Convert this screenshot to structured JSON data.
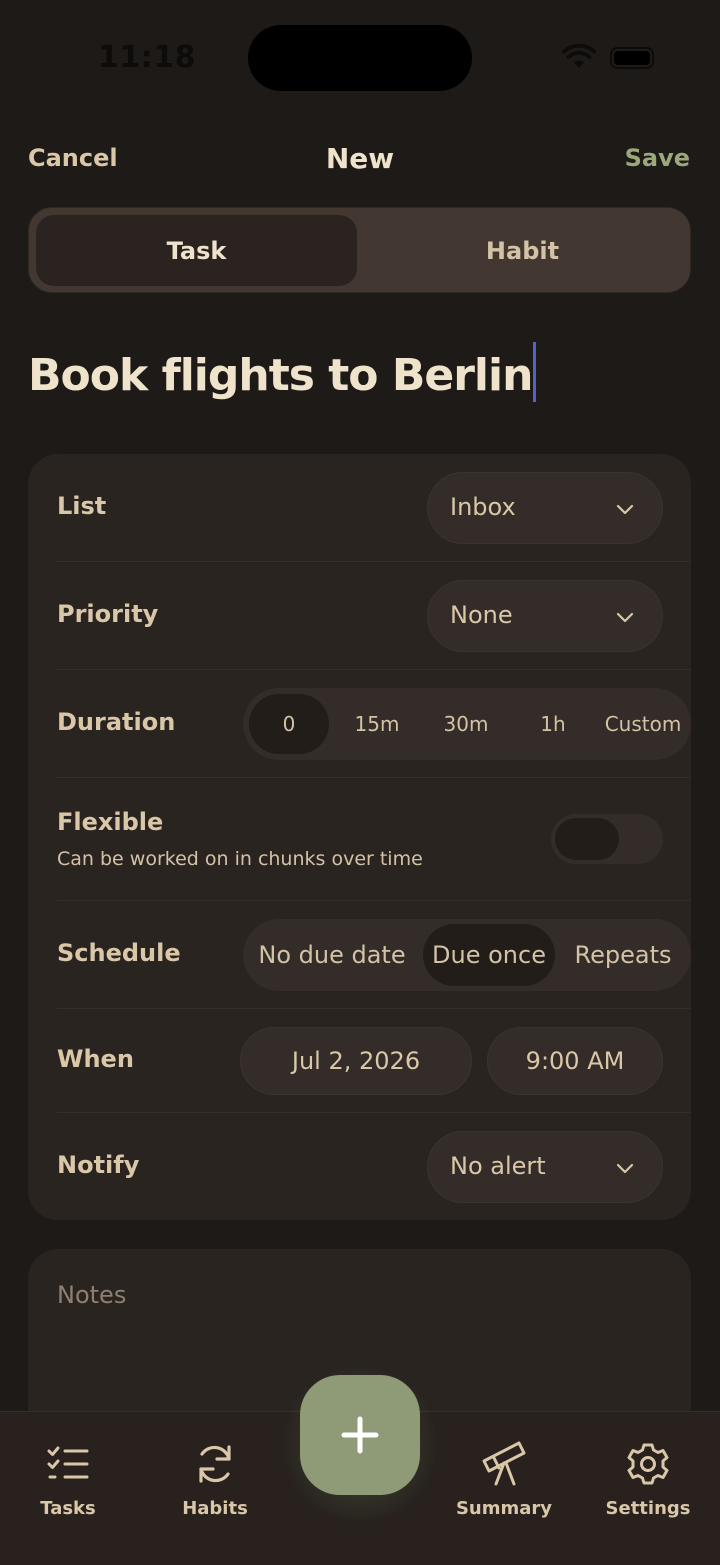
{
  "status_bar": {
    "time": "11:18"
  },
  "nav": {
    "cancel_label": "Cancel",
    "title": "New",
    "save_label": "Save"
  },
  "type_segment": {
    "options": [
      "Task",
      "Habit"
    ],
    "selected": "Task"
  },
  "task_title": "Book flights to Berlin",
  "form": {
    "list": {
      "label": "List",
      "value": "Inbox"
    },
    "priority": {
      "label": "Priority",
      "value": "None"
    },
    "duration": {
      "label": "Duration",
      "options": [
        "0",
        "15m",
        "30m",
        "1h",
        "Custom"
      ],
      "selected": "0"
    },
    "flexible": {
      "label": "Flexible",
      "description": "Can be worked on in chunks over time",
      "enabled": false
    },
    "schedule": {
      "label": "Schedule",
      "options": [
        "No due date",
        "Due once",
        "Repeats"
      ],
      "selected": "Due once"
    },
    "when": {
      "label": "When",
      "date": "Jul 2, 2026",
      "time": "9:00 AM"
    },
    "notify": {
      "label": "Notify",
      "value": "No alert"
    }
  },
  "notes": {
    "placeholder": "Notes"
  },
  "tabbar": {
    "tasks": "Tasks",
    "habits": "Habits",
    "summary": "Summary",
    "settings": "Settings"
  },
  "colors": {
    "background": "#1e1a17",
    "card": "#2a2421",
    "accent_green": "#8f9a77",
    "save_green": "#9aa87c",
    "text_beige": "#d9c7a8",
    "cursor_blue": "#4f63c8"
  }
}
